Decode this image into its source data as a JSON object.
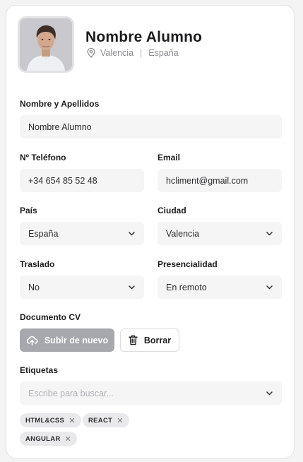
{
  "profile": {
    "name": "Nombre Alumno",
    "city": "Valencia",
    "separator": "|",
    "country": "España"
  },
  "form": {
    "full_name": {
      "label": "Nombre y Apellidos",
      "value": "Nombre Alumno"
    },
    "phone": {
      "label": "Nº Teléfono",
      "value": "+34 654 85 52 48"
    },
    "email": {
      "label": "Email",
      "value": "hcliment@gmail.com"
    },
    "country": {
      "label": "País",
      "value": "España"
    },
    "city": {
      "label": "Ciudad",
      "value": "Valencia"
    },
    "relocation": {
      "label": "Traslado",
      "value": "No"
    },
    "presence": {
      "label": "Presencialidad",
      "value": "En remoto"
    },
    "cv": {
      "label": "Documento CV",
      "upload_label": "Subir de nuevo",
      "delete_label": "Borrar"
    },
    "tags": {
      "label": "Etiquetas",
      "placeholder": "Escribe para buscar...",
      "items": [
        "HTML&CSS",
        "REACT",
        "ANGULAR"
      ],
      "remove_symbol": "✕"
    }
  },
  "colors": {
    "card_bg": "#ffffff",
    "field_bg": "#f5f5f6",
    "upload_button": "#a7a8ad",
    "tag_bg": "#e9e9ec"
  },
  "icons": [
    "location-pin-icon",
    "cloud-upload-icon",
    "trash-icon",
    "chevron-down-icon",
    "close-icon"
  ]
}
